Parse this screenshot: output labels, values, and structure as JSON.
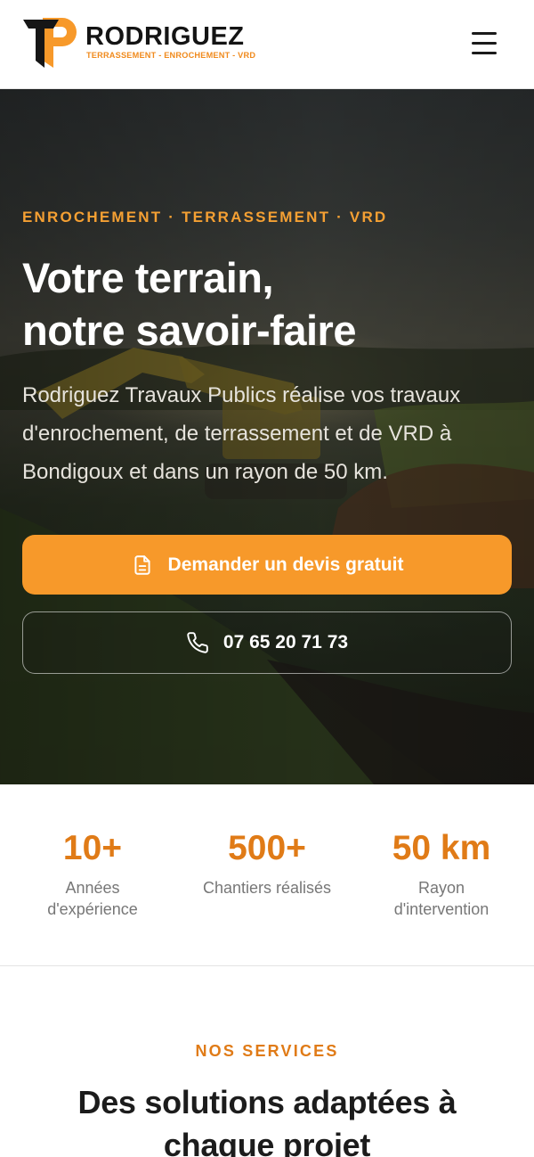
{
  "brand": {
    "name": "RODRIGUEZ",
    "tagline": "TERRASSEMENT - ENROCHEMENT - VRD",
    "colors": {
      "accent": "#f7992a",
      "accent_text": "#e07b17",
      "dark": "#141414"
    }
  },
  "header": {
    "menu_icon": "hamburger-menu-icon"
  },
  "hero": {
    "eyebrow": "ENROCHEMENT · TERRASSEMENT · VRD",
    "title_line1": "Votre terrain,",
    "title_line2": "notre savoir-faire",
    "text": "Rodriguez Travaux Publics réalise vos travaux d'enrochement, de terrassement et de VRD à Bondigoux et dans un rayon de 50 km.",
    "cta_primary": {
      "label": "Demander un devis gratuit",
      "icon": "document-icon"
    },
    "cta_secondary": {
      "label": "07 65 20 71 73",
      "icon": "phone-icon"
    }
  },
  "stats": [
    {
      "value": "10+",
      "label_line1": "Années",
      "label_line2": "d'expérience"
    },
    {
      "value": "500+",
      "label_line1": "Chantiers réalisés",
      "label_line2": ""
    },
    {
      "value": "50 km",
      "label_line1": "Rayon",
      "label_line2": "d'intervention"
    }
  ],
  "services": {
    "eyebrow": "NOS SERVICES",
    "title": "Des solutions adaptées à chaque projet"
  }
}
